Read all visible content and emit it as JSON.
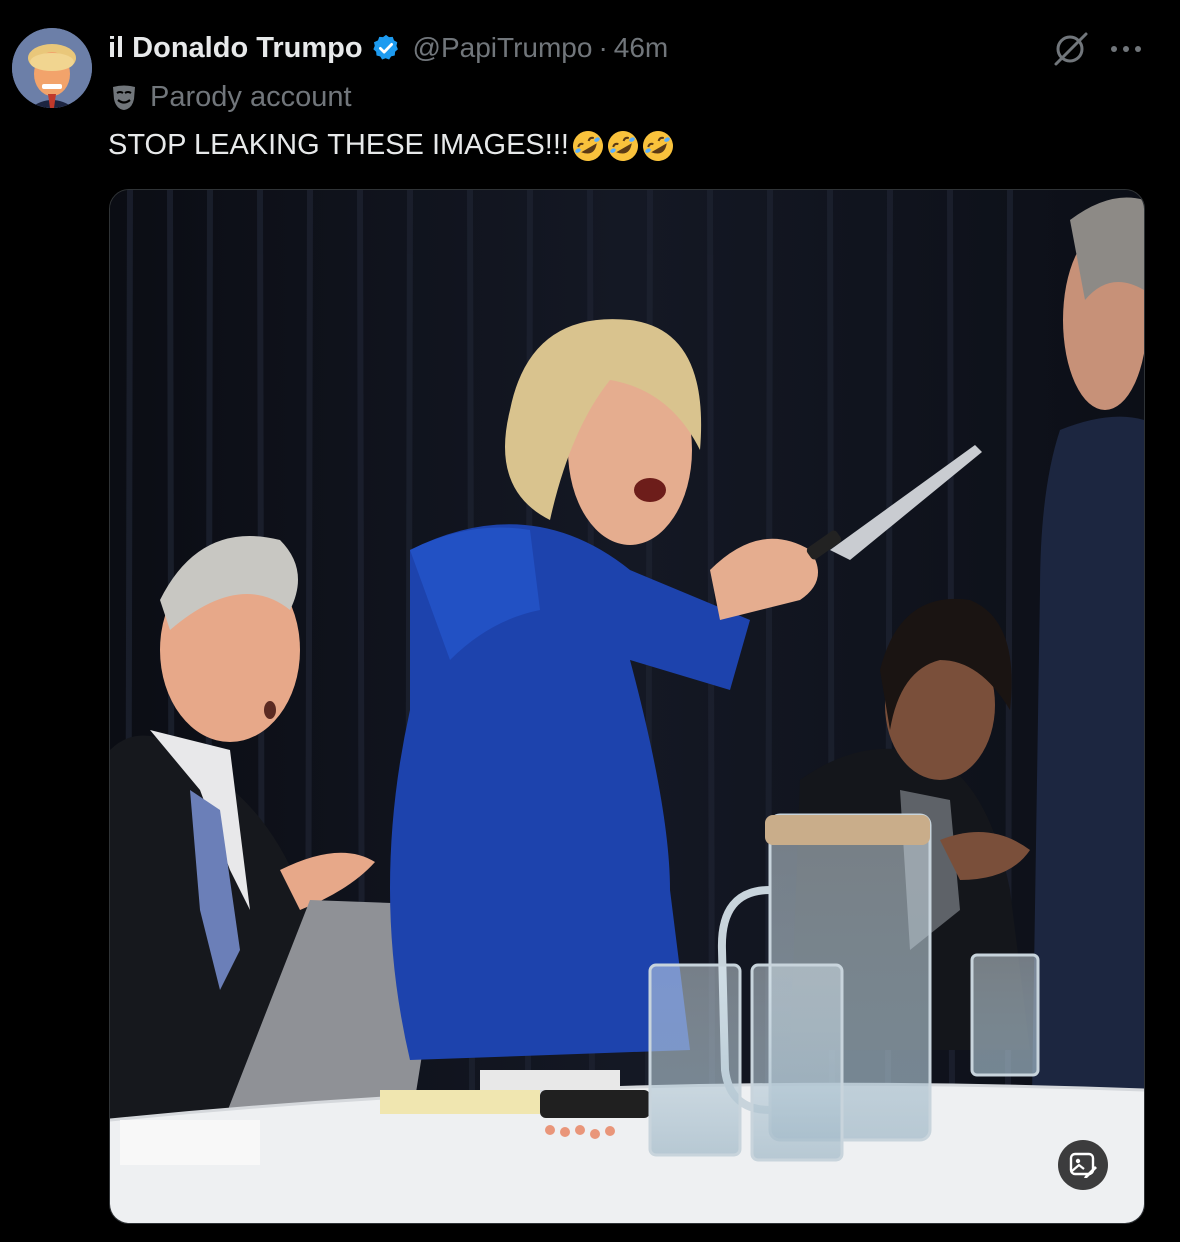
{
  "author": {
    "display_name": "il Donaldo Trumpo",
    "handle": "@PapiTrumpo",
    "separator": "·",
    "time": "46m",
    "verified": true,
    "verified_color": "#1d9bf0",
    "label_icon": "theater-mask-icon",
    "label": "Parody account"
  },
  "tweet": {
    "text": "STOP LEAKING THESE IMAGES!!!",
    "emojis": [
      "rolling-on-floor-laughing-icon",
      "rolling-on-floor-laughing-icon",
      "rolling-on-floor-laughing-icon"
    ]
  },
  "actions": {
    "grok_icon": "grok-icon",
    "more_icon": "more-horizontal-icon"
  },
  "media": {
    "type": "photo",
    "badge_icon": "image-edit-icon"
  },
  "colors": {
    "background": "#000000",
    "text_primary": "#e7e9ea",
    "text_secondary": "#71767b",
    "accent": "#1d9bf0"
  }
}
